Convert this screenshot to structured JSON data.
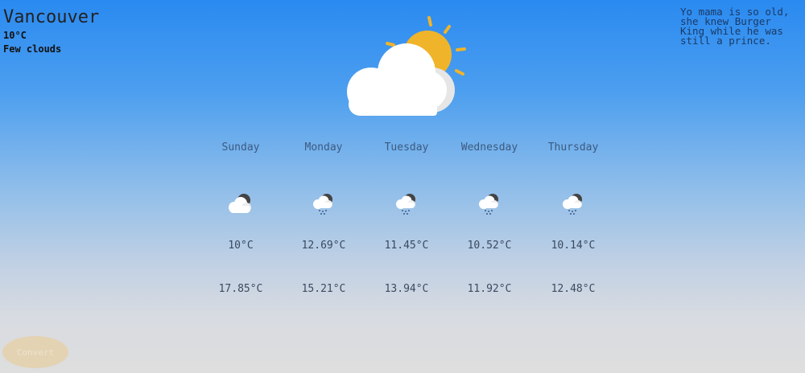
{
  "current": {
    "city": "Vancouver",
    "temp": "10°C",
    "description": "Few clouds",
    "icon": "few-clouds-icon"
  },
  "joke": "Yo mama is so old, she knew Burger King while he was still a prince.",
  "forecast": [
    {
      "day": "Sunday",
      "icon": "partly-cloudy-icon",
      "low": "10°C",
      "high": "17.85°C"
    },
    {
      "day": "Monday",
      "icon": "night-rain-icon",
      "low": "12.69°C",
      "high": "15.21°C"
    },
    {
      "day": "Tuesday",
      "icon": "night-rain-icon",
      "low": "11.45°C",
      "high": "13.94°C"
    },
    {
      "day": "Wednesday",
      "icon": "night-rain-icon",
      "low": "10.52°C",
      "high": "11.92°C"
    },
    {
      "day": "Thursday",
      "icon": "night-rain-icon",
      "low": "10.14°C",
      "high": "12.48°C"
    }
  ],
  "button": {
    "label": "Convert"
  },
  "colors": {
    "sky_top": "#2a8af0",
    "sky_bottom": "#dedede",
    "sun": "#f0b42a",
    "cloud": "#ffffff",
    "button": "#e3d3b3"
  }
}
